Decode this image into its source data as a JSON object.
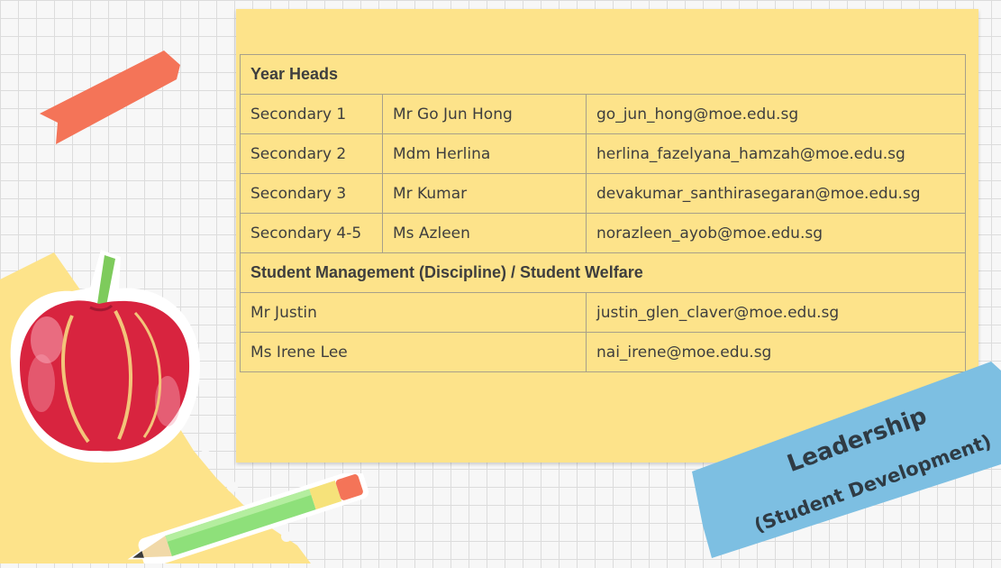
{
  "sections": {
    "year_heads": {
      "title": "Year Heads",
      "rows": [
        {
          "level": "Secondary 1",
          "name": "Mr Go Jun Hong",
          "email": "go_jun_hong@moe.edu.sg"
        },
        {
          "level": "Secondary 2",
          "name": "Mdm Herlina",
          "email": "herlina_fazelyana_hamzah@moe.edu.sg"
        },
        {
          "level": "Secondary 3",
          "name": "Mr Kumar",
          "email": "devakumar_santhirasegaran@moe.edu.sg"
        },
        {
          "level": "Secondary 4-5",
          "name": "Ms Azleen",
          "email": "norazleen_ayob@moe.edu.sg"
        }
      ]
    },
    "student_management": {
      "title": "Student Management (Discipline) / Student Welfare",
      "rows": [
        {
          "name": "Mr Justin",
          "email": "justin_glen_claver@moe.edu.sg"
        },
        {
          "name": "Ms Irene Lee",
          "email": "nai_irene@moe.edu.sg"
        }
      ]
    }
  },
  "banner": {
    "line1": "Leadership",
    "line2": "(Student Development)"
  },
  "decorations": {
    "apple": "apple-icon",
    "pencil": "pencil-icon",
    "red_ribbon": "red-ribbon-icon",
    "blue_ribbon": "blue-ribbon-banner",
    "torn_paper": "torn-note-paper"
  },
  "colors": {
    "card": "#fde38a",
    "grid_line": "#dcdcdc",
    "table_border": "#a7a08a",
    "text": "#3e3e3e",
    "blue_ribbon": "#7dbfe2",
    "red_ribbon": "#f47458",
    "apple_red": "#d8243f"
  }
}
